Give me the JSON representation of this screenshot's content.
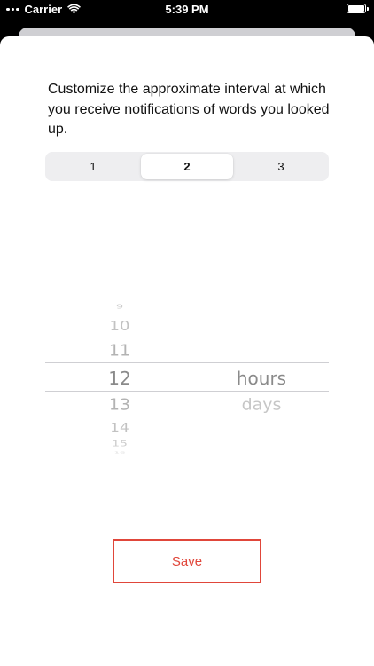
{
  "status_bar": {
    "carrier": "Carrier",
    "time": "5:39 PM"
  },
  "description": "Customize the approximate interval at which you receive notifications of words you looked up.",
  "segmented_control": {
    "segments": [
      "1",
      "2",
      "3"
    ],
    "selected": "2"
  },
  "picker": {
    "numbers": [
      "9",
      "10",
      "11",
      "12",
      "13",
      "14",
      "15",
      "16"
    ],
    "selected_number": "12",
    "units": [
      "hours",
      "days"
    ],
    "selected_unit": "hours"
  },
  "save_button": {
    "label": "Save"
  },
  "colors": {
    "accent": "#e0463a",
    "picker_line": "#cfcfd3",
    "segment_bg": "#eeeef0"
  }
}
